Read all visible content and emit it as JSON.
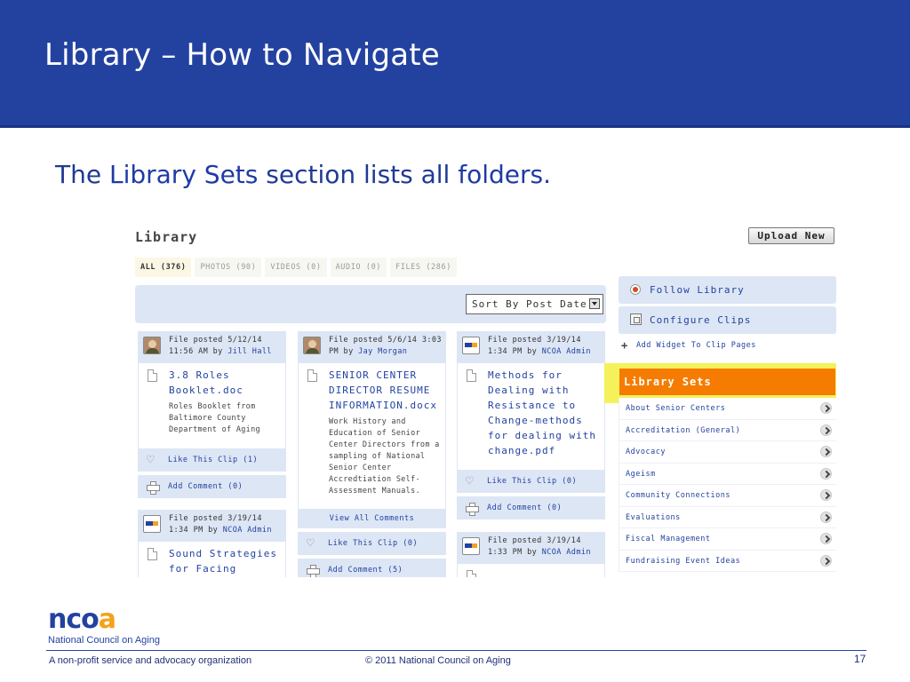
{
  "slide": {
    "title": "Library – How to Navigate",
    "subtitle": {
      "prefix": "The ",
      "highlight1": "Library Sets",
      "middle": " section lists all ",
      "highlight2": "folders",
      "suffix": "."
    }
  },
  "library": {
    "title": "Library",
    "upload_label": "Upload New",
    "tabs": [
      "ALL (376)",
      "PHOTOS (90)",
      "VIDEOS (0)",
      "AUDIO (0)",
      "FILES (286)"
    ],
    "sort_label": "Sort By Post Date",
    "cards": {
      "c1": {
        "posted": "File posted 5/12/14 11:56 AM by ",
        "author": "Jill Hall",
        "title": "3.8 Roles Booklet.doc",
        "desc": "Roles Booklet from Baltimore County Department of Aging",
        "like": "Like This Clip (1)",
        "comment": "Add Comment (0)"
      },
      "c2": {
        "posted": "File posted 3/19/14 1:34 PM by ",
        "author": "NCOA Admin",
        "title": "Sound Strategies for Facing"
      },
      "c3": {
        "posted": "File posted 5/6/14 3:03 PM by ",
        "author": "Jay Morgan",
        "title": "SENIOR CENTER DIRECTOR RESUME INFORMATION.docx",
        "desc": "Work History and Education of Senior Center Directors from a sampling of National Senior Center Accredtiation Self-Assessment Manuals.",
        "view_all": "View All Comments",
        "like": "Like This Clip (0)",
        "comment": "Add Comment (5)"
      },
      "c4": {
        "posted": "File posted 3/19/14 1:34 PM by ",
        "author": "NCOA Admin",
        "title": "Methods for Dealing with Resistance to Change-methods for dealing with change.pdf",
        "like": "Like This Clip (0)",
        "comment": "Add Comment (0)"
      },
      "c5": {
        "posted": "File posted 3/19/14 1:33 PM by ",
        "author": "NCOA Admin"
      }
    },
    "sidebar": {
      "follow": "Follow Library",
      "configure": "Configure Clips",
      "add_widget": "Add Widget To Clip Pages",
      "sets_title": "Library Sets",
      "sets": [
        "About Senior Centers",
        "Accreditation (General)",
        "Advocacy",
        "Ageism",
        "Community Connections",
        "Evaluations",
        "Fiscal Management",
        "Fundraising Event Ideas"
      ]
    }
  },
  "footer": {
    "logo_n": "nco",
    "logo_a": "a",
    "org_name": "National Council on Aging",
    "tagline": "A non-profit service and advocacy organization",
    "copyright": "© 2011 National Council on Aging",
    "page_number": "17"
  },
  "colors": {
    "brand_blue": "#2342a0",
    "accent_orange": "#f57c00",
    "highlight_yellow": "#f5f15a",
    "logo_orange": "#f3a21b"
  }
}
